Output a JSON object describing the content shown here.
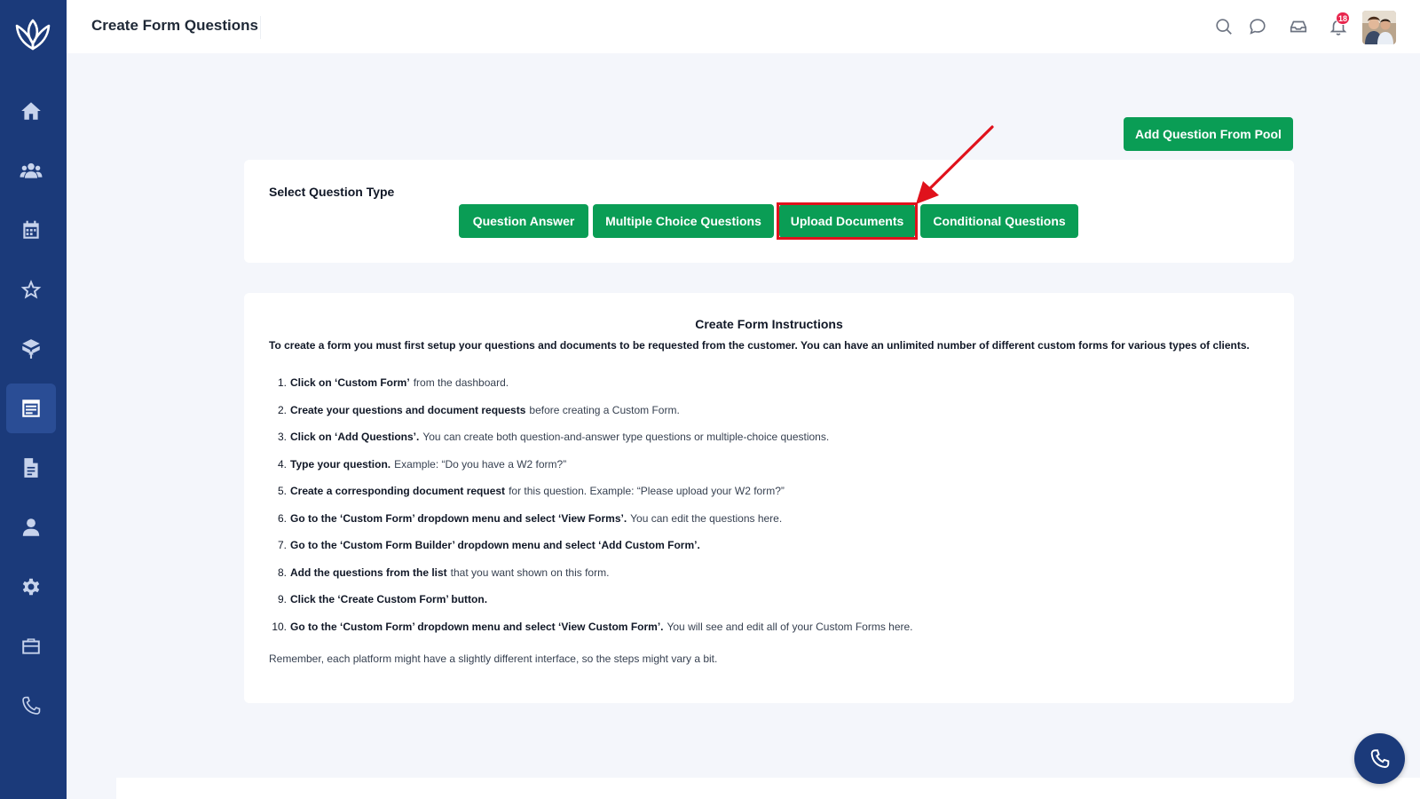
{
  "header": {
    "title": "Create Form Questions",
    "notification_count": "18",
    "icons": [
      "search-icon",
      "chat-icon",
      "inbox-icon",
      "bell-icon"
    ]
  },
  "sidebar": {
    "items": [
      {
        "icon": "home-icon"
      },
      {
        "icon": "users-icon"
      },
      {
        "icon": "calendar-icon"
      },
      {
        "icon": "star-icon"
      },
      {
        "icon": "box-icon"
      },
      {
        "icon": "form-builder-icon",
        "active": true
      },
      {
        "icon": "document-icon"
      },
      {
        "icon": "user-icon"
      },
      {
        "icon": "gear-icon"
      },
      {
        "icon": "briefcase-icon"
      },
      {
        "icon": "phone-icon"
      }
    ]
  },
  "actions": {
    "add_pool": "Add Question From Pool"
  },
  "question_type": {
    "label": "Select Question Type",
    "buttons": [
      "Question Answer",
      "Multiple Choice Questions",
      "Upload Documents",
      "Conditional Questions"
    ],
    "highlighted": "Upload Documents"
  },
  "instructions": {
    "heading": "Create Form Instructions",
    "intro": "To create a form you must first setup your questions and documents to be requested from the customer. You can have an unlimited number of different custom forms for various types of clients.",
    "steps": [
      {
        "num": "1.",
        "bold": "Click on ‘Custom Form’",
        "rest": "from the dashboard."
      },
      {
        "num": "2.",
        "bold": "Create your questions and document requests",
        "rest": "before creating a Custom Form."
      },
      {
        "num": "3.",
        "bold": "Click on ‘Add Questions’.",
        "rest": "You can create both question-and-answer type questions or multiple-choice questions."
      },
      {
        "num": "4.",
        "bold": "Type your question.",
        "rest": "Example: “Do you have a W2 form?”"
      },
      {
        "num": "5.",
        "bold": "Create a corresponding document request",
        "rest": "for this question. Example: “Please upload your W2 form?”"
      },
      {
        "num": "6.",
        "bold": "Go to the ‘Custom Form’ dropdown menu and select ‘View Forms’.",
        "rest": "You can edit the questions here."
      },
      {
        "num": "7.",
        "bold": "Go to the ‘Custom Form Builder’ dropdown menu and select ‘Add Custom Form’.",
        "rest": ""
      },
      {
        "num": "8.",
        "bold": "Add the questions from the list",
        "rest": "that you want shown on this form."
      },
      {
        "num": "9.",
        "bold": "Click the ‘Create Custom Form’ button.",
        "rest": ""
      },
      {
        "num": "10.",
        "bold": "Go to the ‘Custom Form’ dropdown menu and select ‘View Custom Form’.",
        "rest": "You will see and edit all of your Custom Forms here."
      }
    ],
    "footer": "Remember, each platform might have a slightly different interface, so the steps might vary a bit."
  },
  "colors": {
    "sidebar": "#1b3a7a",
    "accent_green": "#0a9d55",
    "highlight_red": "#e0121c",
    "badge_red": "#e8254d"
  }
}
